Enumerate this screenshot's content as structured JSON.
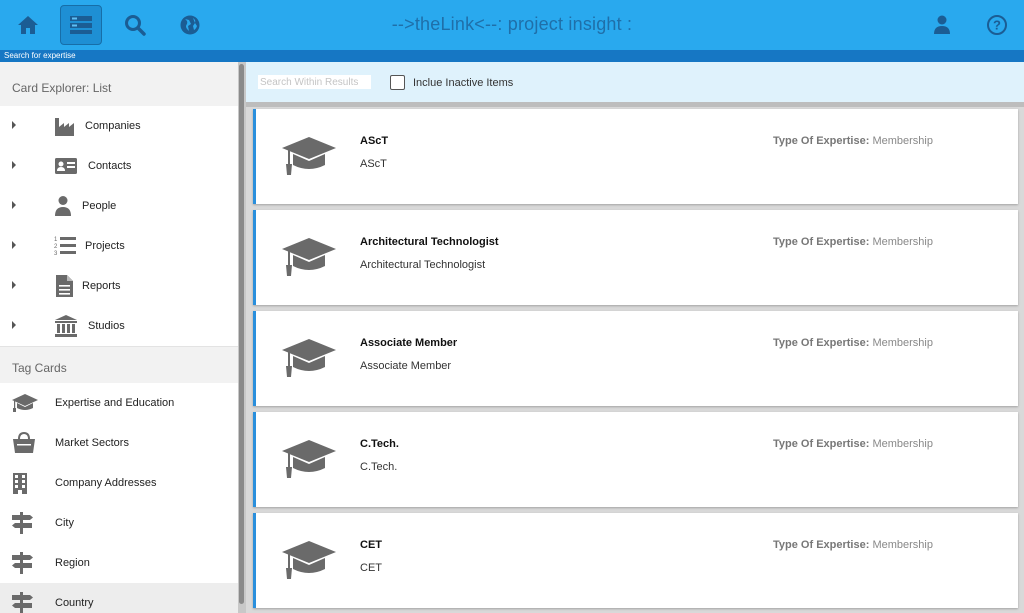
{
  "header": {
    "title": "-->theLink<--: project insight :",
    "search_hint": "Search for expertise"
  },
  "sidebar": {
    "explorer_heading": "Card Explorer: List",
    "tree_items": [
      {
        "label": "Companies",
        "icon": "factory-icon"
      },
      {
        "label": "Contacts",
        "icon": "contact-card-icon"
      },
      {
        "label": "People",
        "icon": "person-icon"
      },
      {
        "label": "Projects",
        "icon": "numbered-list-icon"
      },
      {
        "label": "Reports",
        "icon": "document-icon"
      },
      {
        "label": "Studios",
        "icon": "building-columns-icon"
      }
    ],
    "tags_heading": "Tag Cards",
    "tag_items": [
      {
        "label": "Expertise and Education",
        "icon": "graduation-cap-icon"
      },
      {
        "label": "Market Sectors",
        "icon": "shopping-bag-icon"
      },
      {
        "label": "Company Addresses",
        "icon": "office-building-icon"
      },
      {
        "label": "City",
        "icon": "signpost-icon"
      },
      {
        "label": "Region",
        "icon": "signpost-icon"
      },
      {
        "label": "Country",
        "icon": "signpost-icon"
      }
    ]
  },
  "filter": {
    "search_placeholder": "Search Within Results",
    "search_value": "",
    "inactive_label": "Inclue Inactive Items",
    "inactive_checked": false
  },
  "cards": [
    {
      "title": "AScT",
      "subtitle": "AScT",
      "type_label": "Type Of Expertise:",
      "type_value": "Membership"
    },
    {
      "title": "Architectural Technologist",
      "subtitle": "Architectural Technologist",
      "type_label": "Type Of Expertise:",
      "type_value": "Membership"
    },
    {
      "title": "Associate Member",
      "subtitle": "Associate Member",
      "type_label": "Type Of Expertise:",
      "type_value": "Membership"
    },
    {
      "title": "C.Tech.",
      "subtitle": "C.Tech.",
      "type_label": "Type Of Expertise:",
      "type_value": "Membership"
    },
    {
      "title": "CET",
      "subtitle": "CET",
      "type_label": "Type Of Expertise:",
      "type_value": "Membership"
    }
  ],
  "colors": {
    "topbar": "#29a9ee",
    "accent": "#2a8fdc",
    "icon_gray": "#6a6a6a"
  }
}
